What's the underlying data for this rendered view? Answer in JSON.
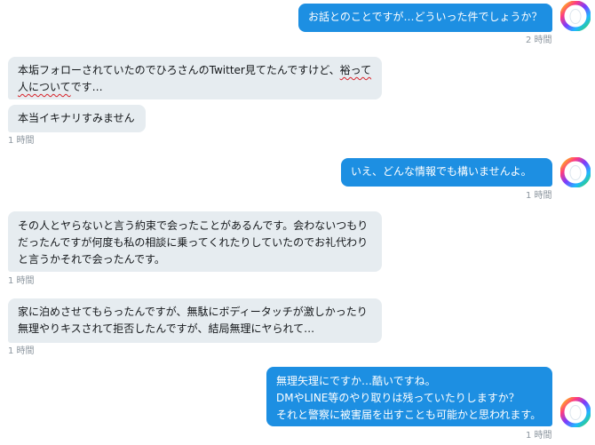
{
  "messages": [
    {
      "side": "sent",
      "text": "お話とのことですが…どういった件でしょうか？",
      "time": "2 時間"
    },
    {
      "side": "received",
      "text_before": "本垢フォローされていたのでひろさんのTwitter見てたんですけど、",
      "text_flagged": "裕って人について",
      "text_after": "です…"
    },
    {
      "side": "received",
      "text": "本当イキナリすみません",
      "time": "1 時間"
    },
    {
      "side": "sent",
      "text": "いえ、どんな情報でも構いませんよ。",
      "time": "1 時間"
    },
    {
      "side": "received",
      "text": "その人とヤらないと言う約束で会ったことがあるんです。会わないつもりだったんですが何度も私の相談に乗ってくれたりしていたのでお礼代わりと言うかそれで会ったんです。",
      "time": "1 時間"
    },
    {
      "side": "received",
      "text": "家に泊めさせてもらったんですが、無駄にボディータッチが激しかったり無理やりキスされて拒否したんですが、結局無理にヤられて…",
      "time": "1 時間"
    },
    {
      "side": "sent",
      "text": "無理矢理にですか…酷いですね。\nDMやLINE等のやり取りは残っていたりしますか？\nそれと警察に被害届を出すことも可能かと思われます。",
      "time": "1 時間"
    }
  ],
  "icons": {
    "self_avatar": "rainbow-ring-avatar"
  },
  "colors": {
    "sent_bubble": "#1d8fe2",
    "received_bubble": "#e6ecf0",
    "timestamp": "#8b959e",
    "spellcheck_underline": "#d8232a"
  }
}
